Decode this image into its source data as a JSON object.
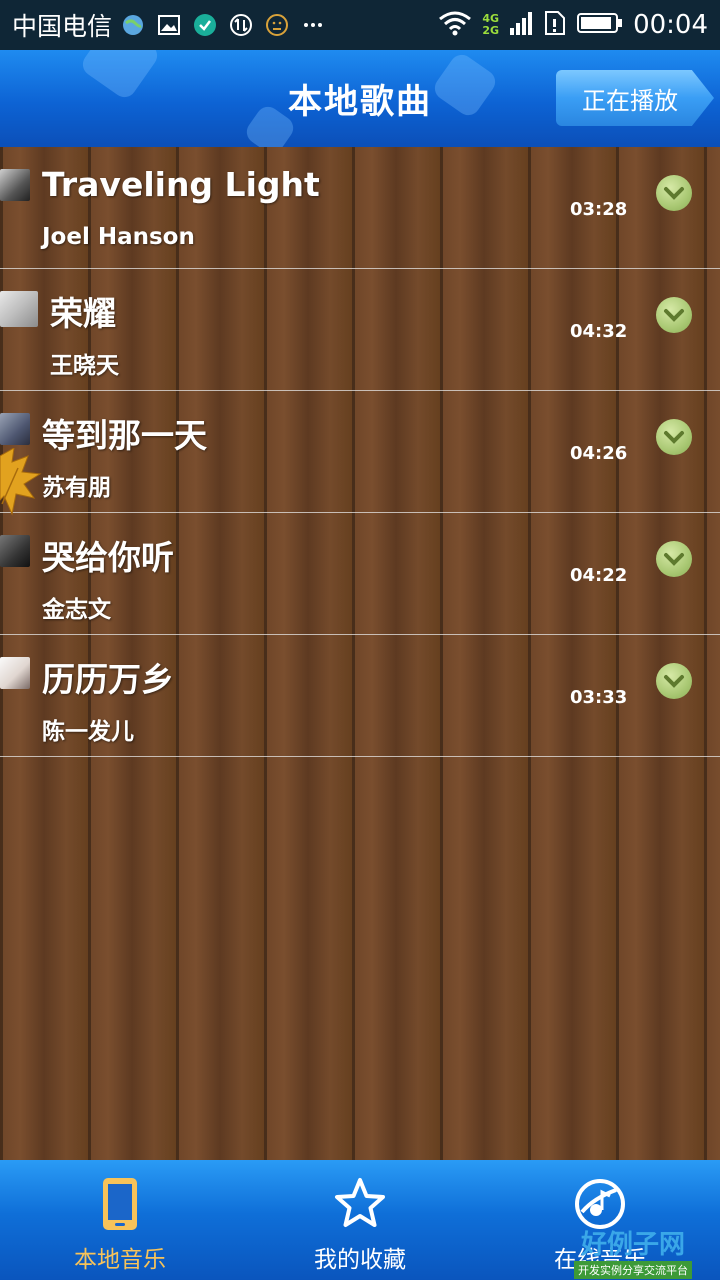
{
  "status_bar": {
    "carrier": "中国电信",
    "network_top": "4G",
    "network_bottom": "2G",
    "time": "00:04",
    "icons": [
      "globe-icon",
      "image-icon",
      "check-icon",
      "sync-icon",
      "face-icon",
      "more-dots-icon",
      "wifi-icon",
      "signal-icon",
      "sim-icon",
      "battery-icon"
    ]
  },
  "header": {
    "title": "本地歌曲",
    "now_playing_label": "正在播放"
  },
  "songs": [
    {
      "title": "Traveling Light",
      "artist": "Joel Hanson",
      "duration": "03:28"
    },
    {
      "title": "荣耀",
      "artist": "王晓天",
      "duration": "04:32"
    },
    {
      "title": "等到那一天",
      "artist": "苏有朋",
      "duration": "04:26"
    },
    {
      "title": "哭给你听",
      "artist": "金志文",
      "duration": "04:22"
    },
    {
      "title": "历历万乡",
      "artist": "陈一发儿",
      "duration": "03:33"
    }
  ],
  "tabs": [
    {
      "label": "本地音乐",
      "icon": "phone-icon",
      "active": true
    },
    {
      "label": "我的收藏",
      "icon": "star-icon",
      "active": false
    },
    {
      "label": "在线音乐",
      "icon": "globe-music-icon",
      "active": false
    }
  ],
  "watermark": {
    "main": "好例子网",
    "sub": "开发实例分享交流平台"
  },
  "colors": {
    "header_blue": "#0d63d4",
    "tab_active": "#f7c35a",
    "chevron_green": "#a9c873",
    "wood": "#6e4528"
  }
}
